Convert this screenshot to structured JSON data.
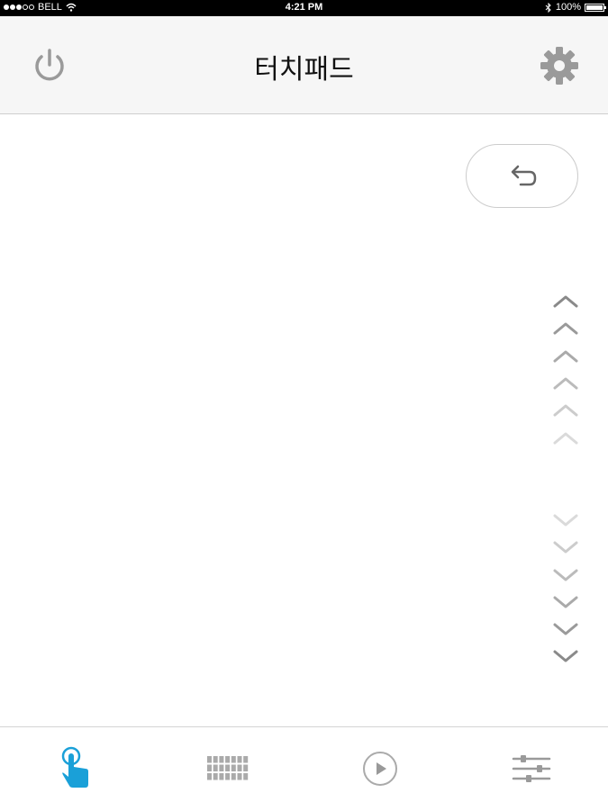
{
  "status_bar": {
    "carrier": "BELL",
    "time": "4:21 PM",
    "battery": "100%",
    "battery_level": 1.0,
    "signal_bars_filled": 3,
    "signal_bars_total": 5
  },
  "header": {
    "title": "터치패드",
    "power_icon": "power-icon",
    "settings_icon": "gear-icon"
  },
  "touchpad": {
    "back_icon": "undo-arrow-icon",
    "scroll_up_icon": "chevron-up-icon",
    "scroll_down_icon": "chevron-down-icon"
  },
  "tabs": [
    {
      "name": "touchpad",
      "icon": "touch-hand-icon",
      "active": true
    },
    {
      "name": "keyboard",
      "icon": "keyboard-icon",
      "active": false
    },
    {
      "name": "media",
      "icon": "play-circle-icon",
      "active": false
    },
    {
      "name": "settings",
      "icon": "sliders-icon",
      "active": false
    }
  ],
  "colors": {
    "accent": "#1aa0d8",
    "icon_gray": "#9a9a9a",
    "header_bg": "#f6f6f6"
  }
}
